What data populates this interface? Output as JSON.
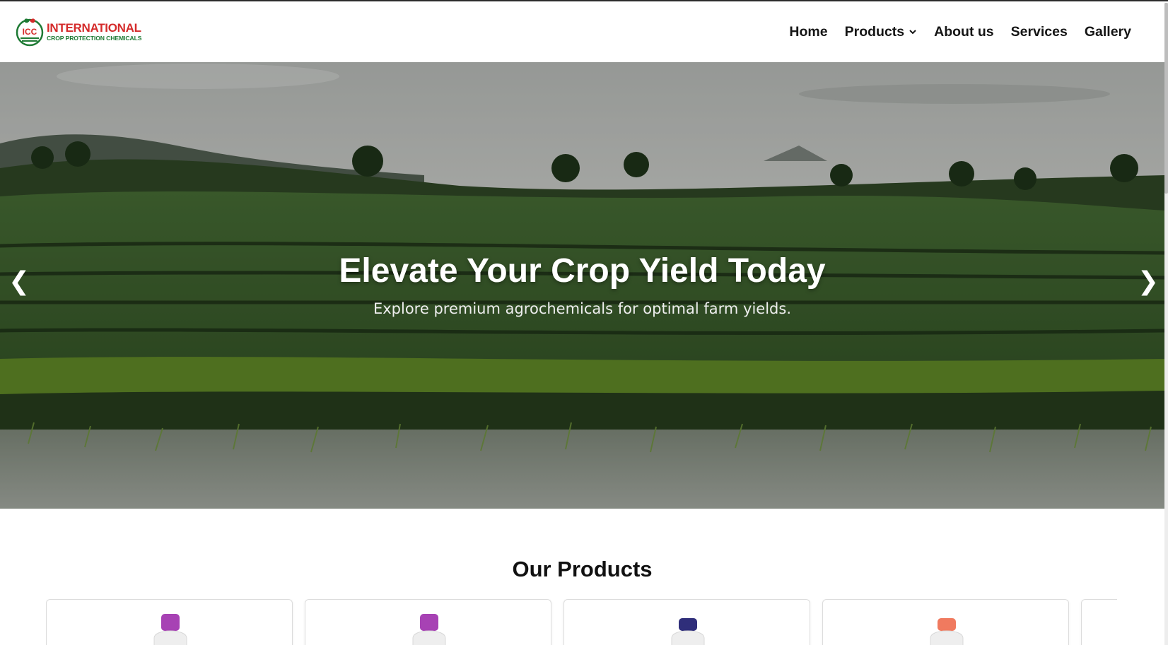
{
  "header": {
    "logo": {
      "mark_text": "ICC",
      "name": "INTERNATIONAL",
      "subtitle": "CROP PROTECTION CHEMICALS",
      "brand_red": "#d42a2a",
      "brand_green": "#1e7a34"
    },
    "nav": [
      {
        "label": "Home"
      },
      {
        "label": "Products",
        "icon": "chevron-down-icon"
      },
      {
        "label": "About us"
      },
      {
        "label": "Services"
      },
      {
        "label": "Gallery"
      }
    ]
  },
  "hero": {
    "title": "Elevate Your Crop Yield Today",
    "subtitle": "Explore premium agrochemicals for optimal farm yields.",
    "prev_glyph": "❮",
    "next_glyph": "❯"
  },
  "products": {
    "title": "Our Products",
    "cards": [
      {
        "cap_color": "#a742b4"
      },
      {
        "cap_color": "#a742b4"
      },
      {
        "cap_color": "#2f2e7a"
      },
      {
        "cap_color": "#f07a5f"
      }
    ]
  }
}
